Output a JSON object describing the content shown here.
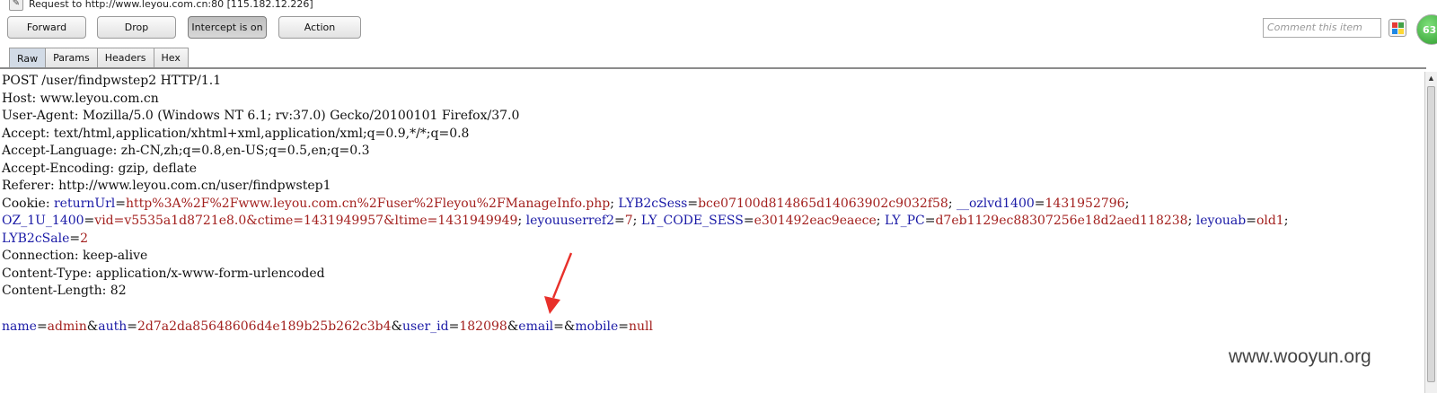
{
  "window": {
    "title": "Request to http://www.leyou.com.cn:80  [115.182.12.226]"
  },
  "toolbar": {
    "forward": "Forward",
    "drop": "Drop",
    "intercept": "Intercept is on",
    "action": "Action",
    "comment_placeholder": "Comment this item",
    "badge": "63"
  },
  "tabs": [
    "Raw",
    "Params",
    "Headers",
    "Hex"
  ],
  "request": {
    "l1": "POST /user/findpwstep2 HTTP/1.1",
    "l2": "Host: www.leyou.com.cn",
    "l3": "User-Agent: Mozilla/5.0 (Windows NT 6.1; rv:37.0) Gecko/20100101 Firefox/37.0",
    "l4": "Accept: text/html,application/xhtml+xml,application/xml;q=0.9,*/*;q=0.8",
    "l5": "Accept-Language: zh-CN,zh;q=0.8,en-US;q=0.5,en;q=0.3",
    "l6": "Accept-Encoding: gzip, deflate",
    "l7": "Referer: http://www.leyou.com.cn/user/findpwstep1",
    "cookie_label": "Cookie: ",
    "c1k": "returnUrl",
    "c1v": "http%3A%2F%2Fwww.leyou.com.cn%2Fuser%2Fleyou%2FManageInfo.php",
    "c2k": "LYB2cSess",
    "c2v": "bce07100d814865d14063902c9032f58",
    "c3k": "__ozlvd1400",
    "c3v": "1431952796",
    "c4k": "OZ_1U_1400",
    "c4v": "vid=v5535a1d8721e8.0&ctime=1431949957&ltime=1431949949",
    "c5k": "leyouuserref2",
    "c5v": "7",
    "c6k": "LY_CODE_SESS",
    "c6v": "e301492eac9eaece",
    "c7k": "LY_PC",
    "c7v": "d7eb1129ec88307256e18d2aed118238",
    "c8k": "leyouab",
    "c8v": "old1",
    "c9k": "LYB2cSale",
    "c9v": "2",
    "l9": "Connection: keep-alive",
    "l10": "Content-Type: application/x-www-form-urlencoded",
    "l11": "Content-Length: 82",
    "b1k": "name",
    "b1v": "admin",
    "b2k": "auth",
    "b2v": "2d7a2da85648606d4e189b25b262c3b4",
    "b3k": "user_id",
    "b3v": "182098",
    "b4k": "email",
    "b5k": "mobile",
    "b5v": "null"
  },
  "watermark": "www.wooyun.org",
  "colors": {
    "key": "#1a1aa6",
    "value": "#a3211f",
    "annotation_arrow": "#e8302a"
  }
}
